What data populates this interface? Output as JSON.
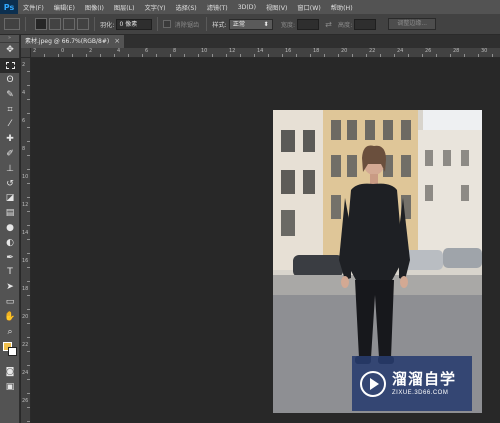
{
  "app": {
    "logo": "Ps"
  },
  "menu": [
    "文件(F)",
    "编辑(E)",
    "图像(I)",
    "图层(L)",
    "文字(Y)",
    "选择(S)",
    "滤镜(T)",
    "3D(D)",
    "视图(V)",
    "窗口(W)",
    "帮助(H)"
  ],
  "options": {
    "feather_label": "羽化:",
    "feather_value": "0 像素",
    "antialias_label": "消除锯齿",
    "style_label": "样式:",
    "style_value": "正常",
    "width_label": "宽度:",
    "height_label": "高度:",
    "refine_edge_button": "调整边缘..."
  },
  "document": {
    "tab_title": "素材.jpeg @ 66.7%(RGB/8#)",
    "close": "×"
  },
  "rulers": {
    "horizontal": [
      "2",
      "0",
      "2",
      "4",
      "6",
      "8",
      "10",
      "12",
      "14",
      "16",
      "18",
      "20",
      "22",
      "24",
      "26",
      "28",
      "30",
      "32"
    ],
    "vertical": [
      "2",
      "4",
      "6",
      "8",
      "10",
      "12",
      "14",
      "16",
      "18",
      "20",
      "22",
      "24",
      "26"
    ]
  },
  "tools": [
    "move-tool-icon",
    "marquee-tool-icon",
    "lasso-tool-icon",
    "quick-select-tool-icon",
    "crop-tool-icon",
    "eyedropper-tool-icon",
    "healing-brush-icon",
    "brush-tool-icon",
    "clone-stamp-icon",
    "history-brush-icon",
    "eraser-tool-icon",
    "gradient-tool-icon",
    "blur-tool-icon",
    "dodge-tool-icon",
    "pen-tool-icon",
    "type-tool-icon",
    "path-select-icon",
    "rectangle-tool-icon",
    "hand-tool-icon",
    "zoom-tool-icon"
  ],
  "colors": {
    "foreground": "#f0bf4b",
    "background": "#ffffff"
  },
  "watermark": {
    "title": "溜溜自学",
    "url": "ZIXUE.3D66.COM"
  }
}
